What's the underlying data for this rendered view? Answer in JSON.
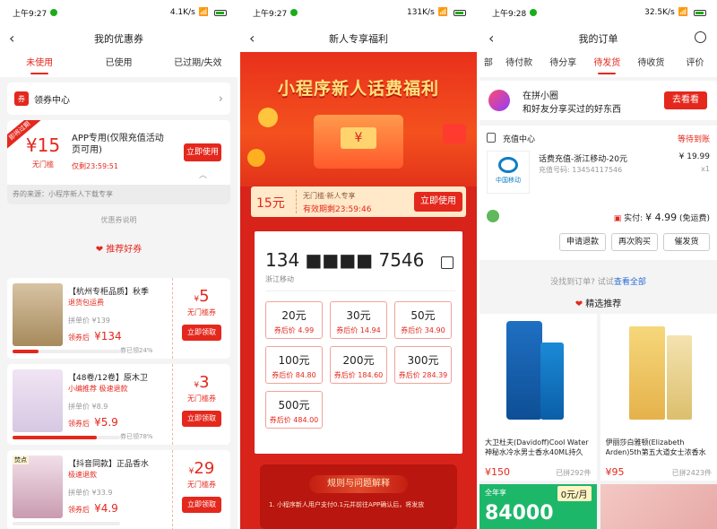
{
  "p1": {
    "status": {
      "time": "上午9:27",
      "speed": "4.1K/s",
      "battery": "87"
    },
    "title": "我的优惠券",
    "tabs": [
      "未使用",
      "已使用",
      "已过期/失效"
    ],
    "center": {
      "icon": "券",
      "label": "领券中心"
    },
    "coupon": {
      "tag": "即将过期",
      "amount": "¥15",
      "cond": "无门槛",
      "desc": "APP专用(仅限充值活动页可用)",
      "expire": "仅剩23:59:51",
      "btn": "立即使用",
      "source": "券的来源：小程序新人下载专享"
    },
    "explain": "优惠券说明",
    "recommend": "推荐好券",
    "goods": [
      {
        "title": "【杭州专柜品质】秋季",
        "sub": "退货包运费",
        "orig": "拼单价 ¥139",
        "after_label": "领券后",
        "after": "¥134",
        "claimed": "券已领24%",
        "progress": 0.24,
        "amt": "5",
        "cond": "无门槛券",
        "btn": "立即领取"
      },
      {
        "title": "【48卷/12卷】原木卫",
        "sub": "小编推荐  极速退款",
        "orig": "拼单价 ¥8.9",
        "after_label": "领券后",
        "after": "¥5.9",
        "claimed": "券已领78%",
        "progress": 0.78,
        "amt": "3",
        "cond": "无门槛券",
        "btn": "立即领取"
      },
      {
        "title": "【抖音同款】正品香水",
        "sub": "极速退款",
        "orig": "拼单价 ¥33.9",
        "after_label": "领券后",
        "after": "¥4.9",
        "claimed": "",
        "progress": 0,
        "amt": "29",
        "cond": "无门槛券",
        "btn": "立即领取",
        "badge": "焚点"
      }
    ]
  },
  "p2": {
    "status": {
      "time": "上午9:27",
      "speed": "131K/s",
      "battery": "87"
    },
    "title": "新人专享福利",
    "banner": "小程序新人话费福利",
    "coupon": {
      "amount": "15元",
      "cond": "无门槛·新人专享",
      "expire": "有效期剩23:59:46",
      "btn": "立即使用"
    },
    "phone": {
      "number": "134  ■■■■  7546",
      "carrier": "浙江移动"
    },
    "prices": [
      {
        "face": "20元",
        "after": "券后价 4.99"
      },
      {
        "face": "30元",
        "after": "券后价 14.94"
      },
      {
        "face": "50元",
        "after": "券后价 34.90"
      },
      {
        "face": "100元",
        "after": "券后价 84.80"
      },
      {
        "face": "200元",
        "after": "券后价 184.60"
      },
      {
        "face": "300元",
        "after": "券后价 284.39"
      },
      {
        "face": "500元",
        "after": "券后价 484.00"
      }
    ],
    "rules_title": "规则与问题解释",
    "rules_text": "1. 小程序新人用户支付0.1元并前往APP确认后，将发放"
  },
  "p3": {
    "status": {
      "time": "上午9:28",
      "speed": "32.5K/s",
      "battery": "87"
    },
    "title": "我的订单",
    "tabs": [
      "部",
      "待付款",
      "待分享",
      "待发货",
      "待收货",
      "评价"
    ],
    "promo": {
      "line1": "在拼小圈",
      "line2": "和好友分享买过的好东西",
      "btn": "去看看"
    },
    "order": {
      "shop": "充值中心",
      "status": "等待到账",
      "title": "话费充值-浙江移动-20元",
      "sub": "充值号码: 13454117546",
      "price": "¥ 19.99",
      "qty": "x1",
      "logo": "中国移动",
      "paid_label": "实付:",
      "paid": "¥ 4.99",
      "paid_note": "(免运费)"
    },
    "actions": [
      "申请退款",
      "再次购买",
      "催发货"
    ],
    "notfound": "没找到订单? 试试",
    "viewall": "查看全部",
    "recommend": "精选推荐",
    "products": [
      {
        "title": "大卫杜夫(Davidoff)Cool Water神秘水冷水男士香水40ML持久",
        "price": "¥150",
        "sold": "已拼292件"
      },
      {
        "title": "伊丽莎白雅顿(Elizabeth Arden)5th第五大道女士浓香水",
        "price": "¥95",
        "sold": "已拼2423件"
      }
    ],
    "ad": {
      "left": "全年享",
      "right": "0元/月",
      "big": "84000"
    }
  }
}
